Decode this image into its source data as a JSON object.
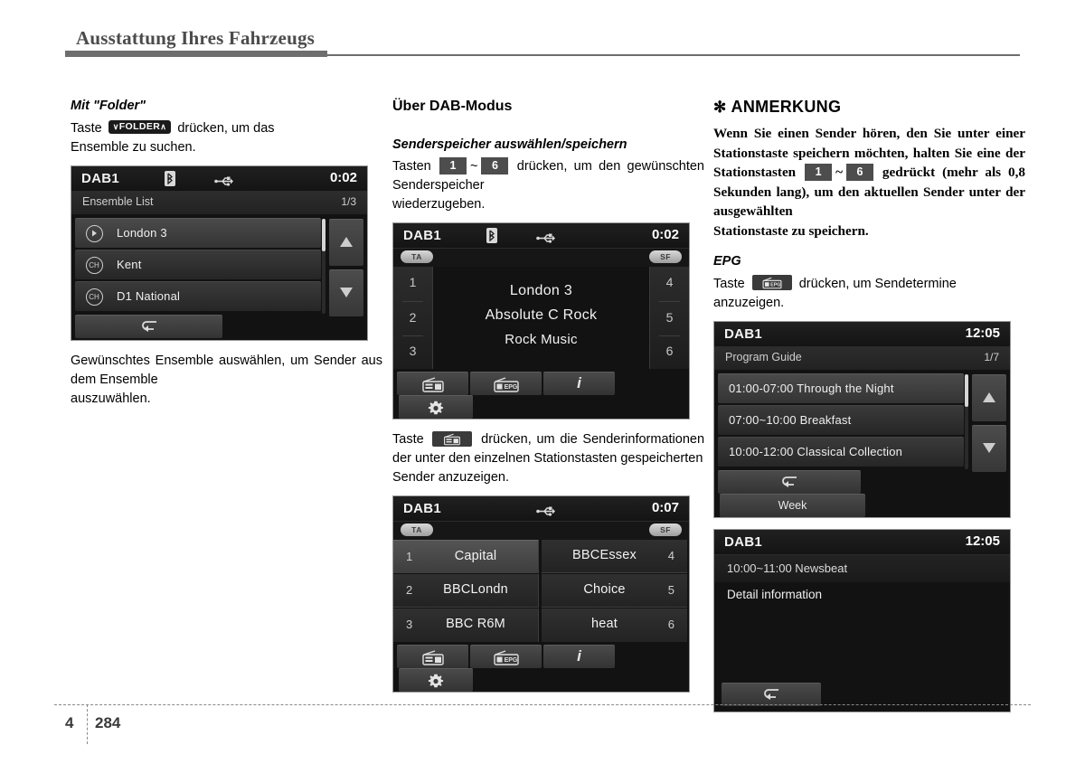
{
  "header": {
    "title": "Ausstattung Ihres Fahrzeugs"
  },
  "footer": {
    "chapter": "4",
    "page": "284"
  },
  "column_left": {
    "sub_head": "Mit \"Folder\"",
    "para_before": "Taste",
    "key_folder": "FOLDER",
    "key_folder_down": "∨",
    "key_folder_up": "∧",
    "para_after": "drücken, um das",
    "para_after_line2": "Ensemble zu suchen.",
    "caption": "Gewünschtes Ensemble auswählen, um Sender aus dem Ensemble",
    "caption_last": "auszuwählen.",
    "screen": {
      "source": "DAB1",
      "clock": "0:02",
      "list_title": "Ensemble List",
      "page_count": "1/3",
      "rows": [
        {
          "label": "London 3",
          "tag": "play"
        },
        {
          "label": "Kent",
          "tag": "ch"
        },
        {
          "label": "D1 National",
          "tag": "ch"
        }
      ],
      "return_icon": "return-arrow-icon",
      "bt_icon": "bluetooth-icon",
      "usb_icon": "usb-icon"
    }
  },
  "column_middle": {
    "sec_head": "Über DAB-Modus",
    "sub_head": "Senderspeicher auswählen/speichern",
    "para_before": "Tasten",
    "key_1": "1",
    "key_6": "6",
    "tilde": "~",
    "para_after": "drücken, um den gewünschten Senderspeicher",
    "para_after_last": "wiederzugeben.",
    "screen_now_playing": {
      "source": "DAB1",
      "clock": "0:02",
      "badge_ta": "TA",
      "badge_sf": "SF",
      "presets_left": [
        "1",
        "2",
        "3"
      ],
      "presets_right": [
        "4",
        "5",
        "6"
      ],
      "line1": "London 3",
      "line2": "Absolute C Rock",
      "line3": "Rock Music",
      "bottom_buttons": [
        "radio-preset-icon",
        "radio-epg-icon",
        "info-icon",
        "settings-gear-icon"
      ]
    },
    "para2_before": "Taste",
    "para2_icon": "radio-preset-icon",
    "para2_after": "drücken, um die Senderinformationen der unter den einzelnen Stationstasten gespeicherten",
    "para2_after_last": "Sender anzuzeigen.",
    "screen_presets": {
      "source": "DAB1",
      "clock": "0:07",
      "badge_ta": "TA",
      "badge_sf": "SF",
      "cells": [
        {
          "num": "1",
          "name": "Capital",
          "side": "left",
          "highlight": true
        },
        {
          "num": "4",
          "name": "BBCEssex",
          "side": "right",
          "highlight": false
        },
        {
          "num": "2",
          "name": "BBCLondn",
          "side": "left",
          "highlight": false
        },
        {
          "num": "5",
          "name": "Choice",
          "side": "right",
          "highlight": false
        },
        {
          "num": "3",
          "name": "BBC R6M",
          "side": "left",
          "highlight": false
        },
        {
          "num": "6",
          "name": "heat",
          "side": "right",
          "highlight": false
        }
      ],
      "bottom_buttons": [
        "radio-preset-icon",
        "radio-epg-icon",
        "info-icon",
        "settings-gear-icon"
      ]
    }
  },
  "column_right": {
    "note_title": "ANMERKUNG",
    "note_star": "✻",
    "note_text_1": "Wenn Sie einen Sender hören, den Sie unter einer Stationstaste speichern möchten, halten Sie eine der Stationstasten",
    "key_1": "1",
    "key_6": "6",
    "tilde": "~",
    "note_text_2": "gedrückt (mehr als 0,8 Sekunden lang), um den aktuellen Sender unter der ausgewählten",
    "note_text_2_last": "Stationstaste zu speichern.",
    "epg_head": "EPG",
    "epg_para_before": "Taste",
    "epg_para_icon": "radio-epg-icon",
    "epg_para_after": "drücken, um Sendetermine",
    "epg_para_after_last": "anzuzeigen.",
    "screen_guide": {
      "source": "DAB1",
      "clock": "12:05",
      "list_title": "Program Guide",
      "page_count": "1/7",
      "rows": [
        "01:00-07:00 Through the Night",
        "07:00~10:00 Breakfast",
        "10:00-12:00 Classical Collection"
      ],
      "btn_return": "return-arrow-icon",
      "btn_week": "Week"
    },
    "screen_detail": {
      "source": "DAB1",
      "clock": "12:05",
      "program": "10:00~11:00 Newsbeat",
      "detail": "Detail information",
      "btn_return": "return-arrow-icon"
    }
  },
  "colors": {
    "header_rule": "#6e6e6e",
    "screen_bg": "#121212",
    "key_badge": "#4d4d4d"
  }
}
